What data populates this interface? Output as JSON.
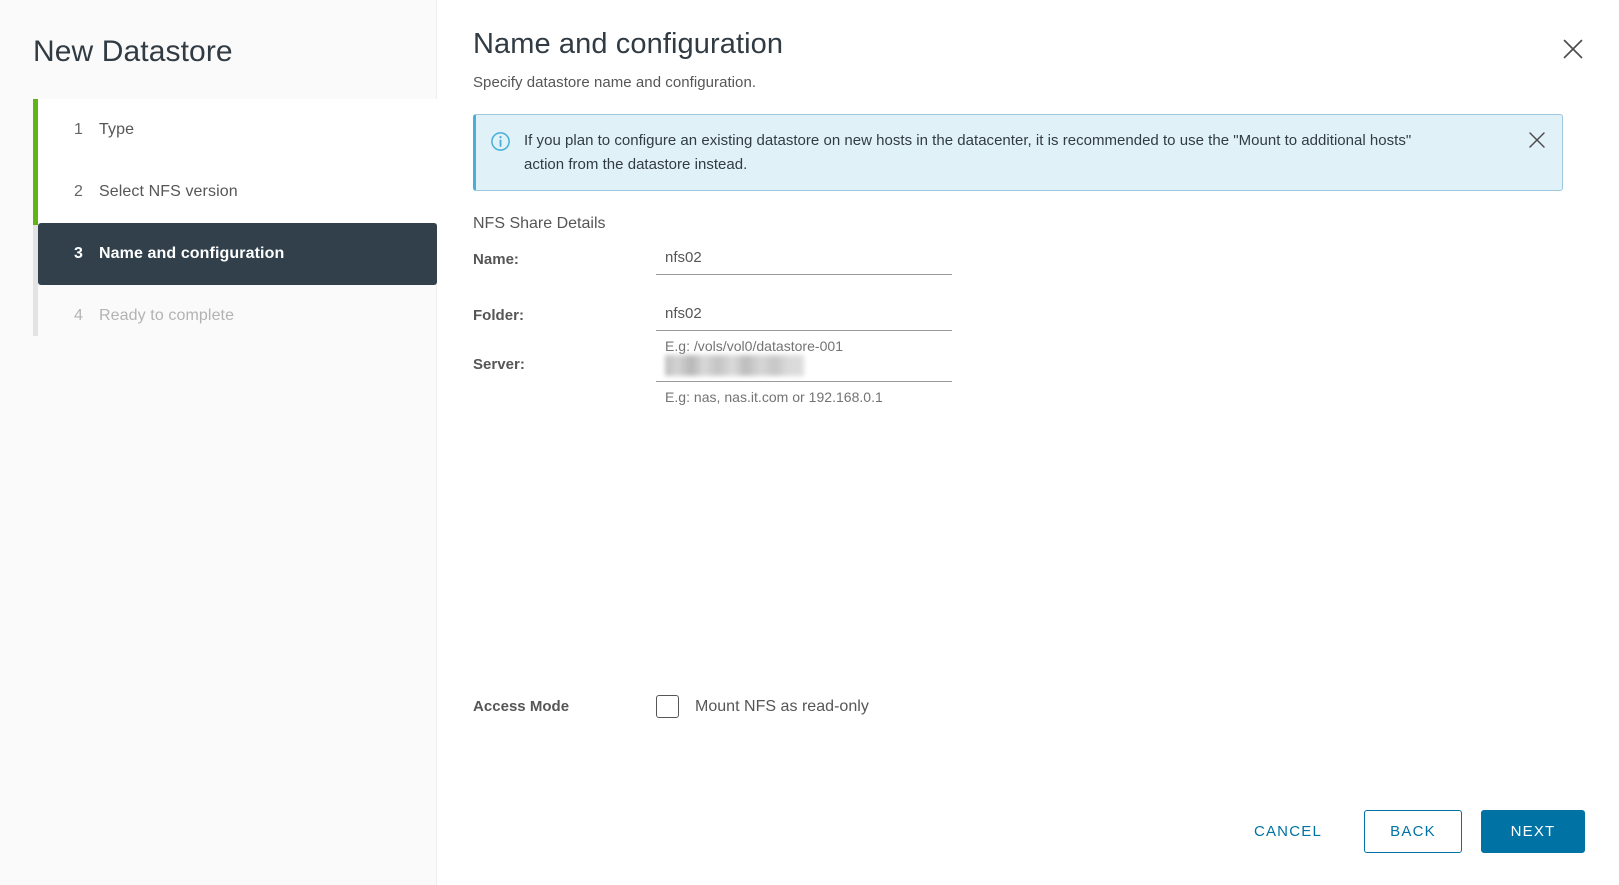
{
  "sidebar": {
    "title": "New Datastore",
    "steps": [
      {
        "num": "1",
        "label": "Type",
        "state": "done"
      },
      {
        "num": "2",
        "label": "Select NFS version",
        "state": "done"
      },
      {
        "num": "3",
        "label": "Name and configuration",
        "state": "active"
      },
      {
        "num": "4",
        "label": "Ready to complete",
        "state": "future"
      }
    ]
  },
  "header": {
    "title": "Name and configuration",
    "subtitle": "Specify datastore name and configuration.",
    "close_icon": "close-icon"
  },
  "alert": {
    "icon": "info-circle-icon",
    "text": "If you plan to configure an existing datastore on new hosts in the datacenter, it is recommended to use the \"Mount to additional hosts\" action from the datastore instead.",
    "close_icon": "close-icon",
    "background": "#e1f1f8",
    "accent": "#49afd9"
  },
  "form": {
    "section_title": "NFS Share Details",
    "name": {
      "label": "Name:",
      "value": "nfs02",
      "placeholder": ""
    },
    "folder": {
      "label": "Folder:",
      "value": "nfs02",
      "placeholder": "",
      "hint": "E.g: /vols/vol0/datastore-001"
    },
    "server": {
      "label": "Server:",
      "value": "",
      "placeholder": "",
      "hint": "E.g: nas, nas.it.com or 192.168.0.1",
      "redacted": true
    },
    "access_mode": {
      "label": "Access Mode",
      "checkbox_label": "Mount NFS as read-only",
      "checked": false
    }
  },
  "footer": {
    "cancel_label": "Cancel",
    "back_label": "Back",
    "next_label": "Next"
  },
  "colors": {
    "accent_blue": "#0072a3",
    "progress_green": "#60b515",
    "active_step_bg": "#31404b",
    "info_blue": "#49afd9"
  }
}
